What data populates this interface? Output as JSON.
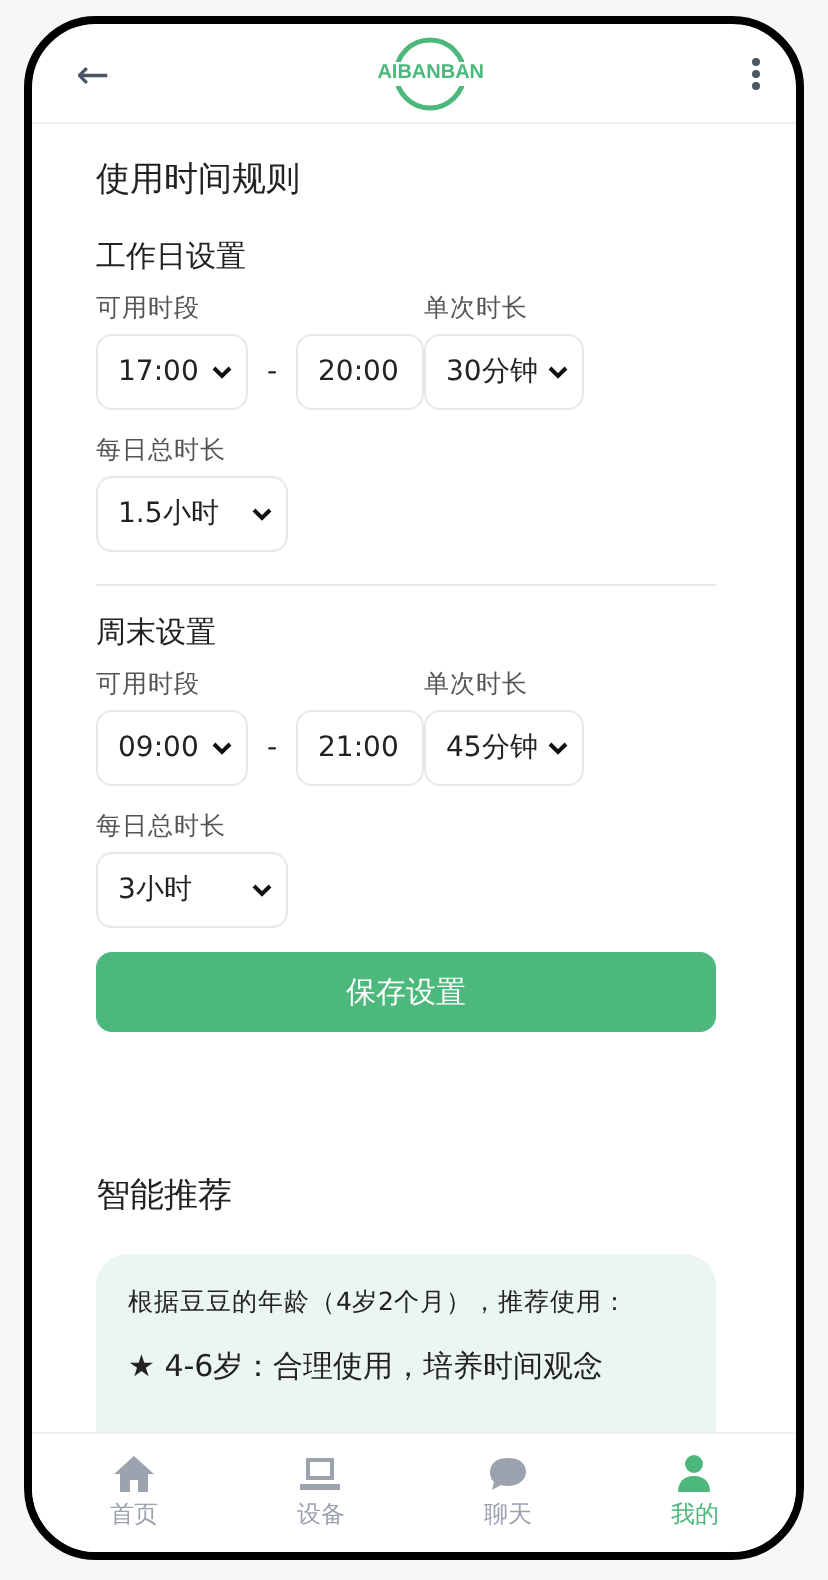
{
  "header": {
    "back_icon": "←",
    "logo": "AIBANBAN"
  },
  "page_title": "使用时间规则",
  "sections": [
    {
      "title": "工作日设置",
      "period_label": "可用时段",
      "start": "17:00",
      "separator": "-",
      "end": "20:00",
      "duration_label": "单次时长",
      "duration": "30分钟",
      "daily_label": "每日总时长",
      "daily": "1.5小时"
    },
    {
      "title": "周末设置",
      "period_label": "可用时段",
      "start": "09:00",
      "separator": "-",
      "end": "21:00",
      "duration_label": "单次时长",
      "duration": "45分钟",
      "daily_label": "每日总时长",
      "daily": "3小时"
    }
  ],
  "save_button": "保存设置",
  "recommendation": {
    "title": "智能推荐",
    "intro": "根据豆豆的年龄（4岁2个月），推荐使用：",
    "items": [
      "★ 4-6岁：合理使用，培养时间观念"
    ]
  },
  "nav": [
    {
      "label": "首页",
      "kind": "home",
      "selected": false
    },
    {
      "label": "设备",
      "kind": "device",
      "selected": false
    },
    {
      "label": "聊天",
      "kind": "chat",
      "selected": false
    },
    {
      "label": "我的",
      "kind": "profile",
      "selected": true
    }
  ]
}
